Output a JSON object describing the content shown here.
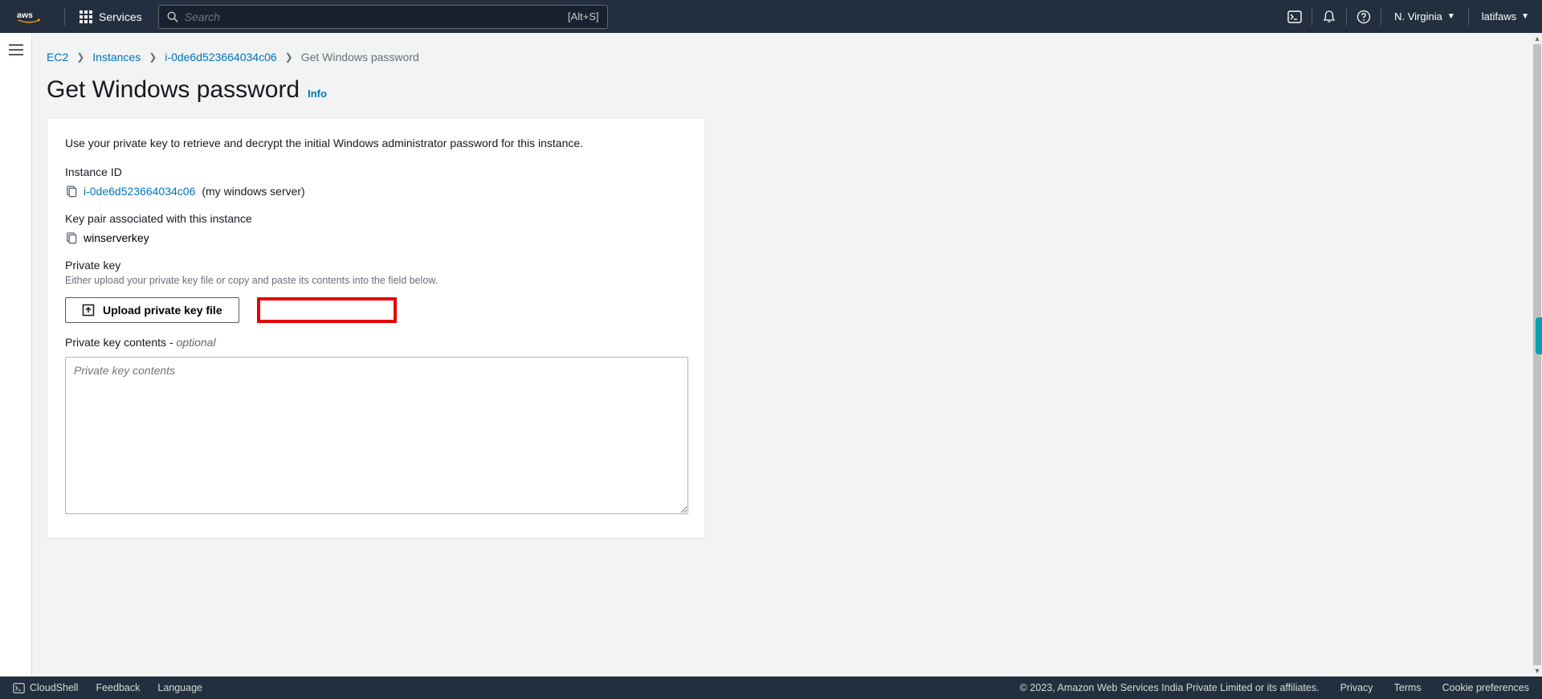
{
  "topnav": {
    "services_label": "Services",
    "search_placeholder": "Search",
    "search_hotkey": "[Alt+S]",
    "region": "N. Virginia",
    "user": "latifaws"
  },
  "breadcrumb": {
    "ec2": "EC2",
    "instances": "Instances",
    "instance_id": "i-0de6d523664034c06",
    "current": "Get Windows password"
  },
  "page": {
    "title": "Get Windows password",
    "info": "Info"
  },
  "panel": {
    "description": "Use your private key to retrieve and decrypt the initial Windows administrator password for this instance.",
    "instance_id_label": "Instance ID",
    "instance_id_value": "i-0de6d523664034c06",
    "instance_name_paren": "(my windows server)",
    "keypair_label": "Key pair associated with this instance",
    "keypair_value": "winserverkey",
    "private_key_label": "Private key",
    "private_key_desc": "Either upload your private key file or copy and paste its contents into the field below.",
    "upload_button": "Upload private key file",
    "pk_contents_label": "Private key contents - ",
    "pk_contents_optional": "optional",
    "pk_textarea_placeholder": "Private key contents"
  },
  "footer": {
    "cloudshell": "CloudShell",
    "feedback": "Feedback",
    "language": "Language",
    "copyright": "© 2023, Amazon Web Services India Private Limited or its affiliates.",
    "privacy": "Privacy",
    "terms": "Terms",
    "cookie": "Cookie preferences"
  }
}
